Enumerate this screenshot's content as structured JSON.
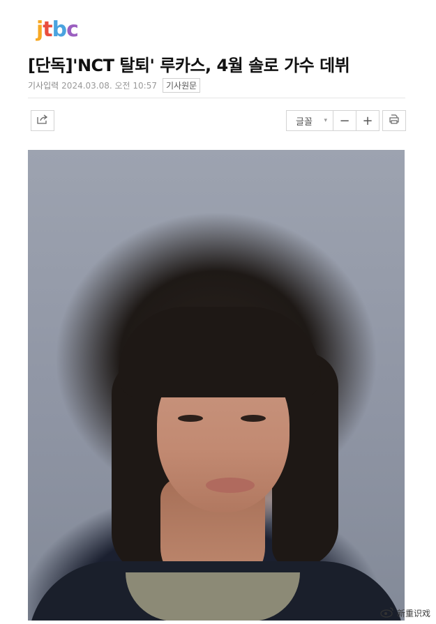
{
  "logo": {
    "letters": [
      "j",
      "t",
      "b",
      "c"
    ],
    "colors": [
      "#f7a823",
      "#e94e3d",
      "#4aa3df",
      "#9b5fc0"
    ]
  },
  "article": {
    "headline": "[단독]'NCT 탈퇴' 루카스, 4월 솔로 가수 데뷔",
    "meta_label": "기사입력",
    "date": "2024.03.08. 오전 10:57",
    "source_button": "기사원문"
  },
  "toolbar": {
    "share_icon": "share-icon",
    "font_label": "글꼴",
    "font_caret": "▾",
    "decrease": "−",
    "increase": "+",
    "print_icon": "print-icon"
  },
  "photo": {
    "kind": "portrait photo"
  },
  "watermark": {
    "icon": "weibo-icon",
    "text": "新重识戏"
  }
}
